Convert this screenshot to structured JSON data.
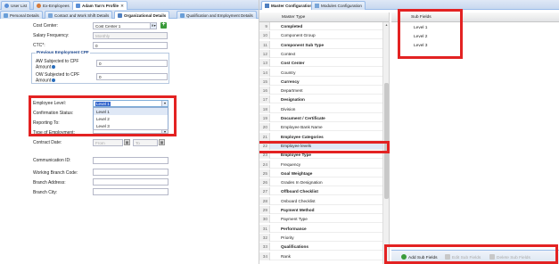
{
  "left_tabs": {
    "items": [
      {
        "label": "User List"
      },
      {
        "label": "Ex-Employees"
      },
      {
        "label": "Adam Tan's Profile"
      }
    ],
    "sub_items": [
      {
        "label": "Personal Details"
      },
      {
        "label": "Contact and Work Shift Details"
      },
      {
        "label": "Organizational Details"
      },
      {
        "label": "Qualification and Employment Details"
      }
    ]
  },
  "org_form": {
    "cost_center": {
      "label": "Cost Center:",
      "value": "Cost Center 1"
    },
    "salary_frequency": {
      "label": "Salary Frequency:",
      "value": "Monthly"
    },
    "ctc": {
      "label": "CTC*:",
      "value": "0"
    },
    "previous_cpf": {
      "legend": "Previous Employment CPF",
      "aw": {
        "label": "AW Subjected to CPF Amount",
        "value": "0"
      },
      "ow": {
        "label": "OW Subjected to CPF Amount",
        "value": "0"
      }
    },
    "employee_level": {
      "label": "Employee Level:",
      "value": "Level 1",
      "options": [
        "Level 1",
        "Level 2",
        "Level 3"
      ]
    },
    "confirmation_status": {
      "label": "Confirmation Status:"
    },
    "reporting_to": {
      "label": "Reporting To:"
    },
    "type_of_employment": {
      "label": "Type of Employment:"
    },
    "contract_date": {
      "label": "Contract Date:",
      "from": "From",
      "to": "To"
    },
    "communication_id": {
      "label": "Communication ID:"
    },
    "working_branch_code": {
      "label": "Working Branch Code:"
    },
    "branch_address": {
      "label": "Branch Address:"
    },
    "branch_city": {
      "label": "Branch City:"
    }
  },
  "right_tabs": {
    "items": [
      {
        "label": "Master Configuration"
      },
      {
        "label": "Modules Configuration"
      }
    ]
  },
  "master_grid": {
    "header": "Master Type",
    "rows": [
      {
        "n": "9",
        "label": "Completed",
        "bold": true
      },
      {
        "n": "10",
        "label": "Component Group",
        "bold": false
      },
      {
        "n": "11",
        "label": "Component Sub Type",
        "bold": true
      },
      {
        "n": "12",
        "label": "Context",
        "bold": false
      },
      {
        "n": "13",
        "label": "Cost Center",
        "bold": true
      },
      {
        "n": "14",
        "label": "Country",
        "bold": false
      },
      {
        "n": "15",
        "label": "Currency",
        "bold": true
      },
      {
        "n": "16",
        "label": "Department",
        "bold": false
      },
      {
        "n": "17",
        "label": "Designation",
        "bold": true
      },
      {
        "n": "18",
        "label": "Division",
        "bold": false
      },
      {
        "n": "19",
        "label": "Document / Certificate",
        "bold": true
      },
      {
        "n": "20",
        "label": "Employee Bank Name",
        "bold": false
      },
      {
        "n": "21",
        "label": "Employee Categories",
        "bold": true
      },
      {
        "n": "22",
        "label": "Employee levels",
        "bold": false,
        "selected": true
      },
      {
        "n": "23",
        "label": "Employee Type",
        "bold": true
      },
      {
        "n": "24",
        "label": "Frequency",
        "bold": false
      },
      {
        "n": "25",
        "label": "Goal Weightage",
        "bold": true
      },
      {
        "n": "26",
        "label": "Grades In Designation",
        "bold": false
      },
      {
        "n": "27",
        "label": "Offboard Checklist",
        "bold": true
      },
      {
        "n": "28",
        "label": "Onboard Checklist",
        "bold": false
      },
      {
        "n": "29",
        "label": "Payment Method",
        "bold": true
      },
      {
        "n": "30",
        "label": "Payment Type",
        "bold": false
      },
      {
        "n": "31",
        "label": "Performance",
        "bold": true
      },
      {
        "n": "32",
        "label": "Priority",
        "bold": false
      },
      {
        "n": "33",
        "label": "Qualifications",
        "bold": true
      },
      {
        "n": "34",
        "label": "Rank",
        "bold": false
      }
    ]
  },
  "sub_fields": {
    "header": "Sub Fields",
    "rows": [
      {
        "n": "1",
        "label": "Level 1"
      },
      {
        "n": "2",
        "label": "Level 2"
      },
      {
        "n": "3",
        "label": "Level 3"
      }
    ]
  },
  "sub_toolbar": {
    "add": "Add Sub Fields",
    "edit": "Edit Sub Fields",
    "delete": "Delete Sub Fields"
  },
  "colors": {
    "highlight": "#e32222",
    "accent": "#15428b",
    "add_green": "#3a9a3a"
  }
}
